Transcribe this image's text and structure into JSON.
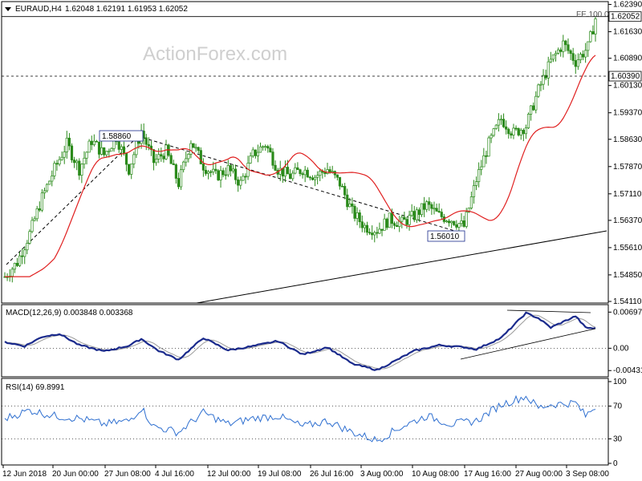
{
  "header": {
    "symbol": "EURAUD,H4",
    "ohlc": "1.62048 1.62191 1.61953 1.62052",
    "watermark": "ActionForex.com"
  },
  "chart_data": [
    {
      "type": "candlestick",
      "name": "price",
      "ylim": [
        1.5411,
        1.6238
      ],
      "y_ticks": [
        "1.62390",
        "1.61630",
        "1.60890",
        "1.60130",
        "1.59370",
        "1.58630",
        "1.57870",
        "1.57110",
        "1.56370",
        "1.55610",
        "1.54850",
        "1.54110"
      ],
      "y_tick_values": [
        1.6239,
        1.6163,
        1.6089,
        1.6013,
        1.5937,
        1.5863,
        1.5787,
        1.5711,
        1.5637,
        1.5561,
        1.5485,
        1.5411
      ],
      "x_ticks": [
        "12 Jun 2018",
        "20 Jun 00:00",
        "27 Jun 08:00",
        "4 Jul 16:00",
        "12 Jul 00:00",
        "19 Jul 08:00",
        "26 Jul 16:00",
        "3 Aug 00:00",
        "10 Aug 08:00",
        "17 Aug 16:00",
        "27 Aug 00:00",
        "3 Sep 08:00"
      ],
      "anchors": [
        {
          "i": 0,
          "v": 1.548
        },
        {
          "i": 5,
          "v": 1.552
        },
        {
          "i": 10,
          "v": 1.56
        },
        {
          "i": 15,
          "v": 1.57
        },
        {
          "i": 20,
          "v": 1.578
        },
        {
          "i": 25,
          "v": 1.585
        },
        {
          "i": 30,
          "v": 1.578
        },
        {
          "i": 35,
          "v": 1.586
        },
        {
          "i": 40,
          "v": 1.582
        },
        {
          "i": 45,
          "v": 1.587
        },
        {
          "i": 50,
          "v": 1.578
        },
        {
          "i": 55,
          "v": 1.5886
        },
        {
          "i": 60,
          "v": 1.58
        },
        {
          "i": 65,
          "v": 1.583
        },
        {
          "i": 70,
          "v": 1.574
        },
        {
          "i": 75,
          "v": 1.586
        },
        {
          "i": 80,
          "v": 1.579
        },
        {
          "i": 85,
          "v": 1.576
        },
        {
          "i": 90,
          "v": 1.578
        },
        {
          "i": 95,
          "v": 1.574
        },
        {
          "i": 100,
          "v": 1.582
        },
        {
          "i": 105,
          "v": 1.585
        },
        {
          "i": 110,
          "v": 1.578
        },
        {
          "i": 115,
          "v": 1.576
        },
        {
          "i": 120,
          "v": 1.578
        },
        {
          "i": 125,
          "v": 1.576
        },
        {
          "i": 130,
          "v": 1.578
        },
        {
          "i": 135,
          "v": 1.574
        },
        {
          "i": 140,
          "v": 1.566
        },
        {
          "i": 145,
          "v": 1.562
        },
        {
          "i": 150,
          "v": 1.561
        },
        {
          "i": 155,
          "v": 1.564
        },
        {
          "i": 160,
          "v": 1.563
        },
        {
          "i": 165,
          "v": 1.565
        },
        {
          "i": 170,
          "v": 1.568
        },
        {
          "i": 175,
          "v": 1.565
        },
        {
          "i": 180,
          "v": 1.564
        },
        {
          "i": 185,
          "v": 1.562
        },
        {
          "i": 190,
          "v": 1.575
        },
        {
          "i": 195,
          "v": 1.585
        },
        {
          "i": 200,
          "v": 1.592
        },
        {
          "i": 205,
          "v": 1.588
        },
        {
          "i": 210,
          "v": 1.59
        },
        {
          "i": 215,
          "v": 1.6
        },
        {
          "i": 220,
          "v": 1.608
        },
        {
          "i": 225,
          "v": 1.613
        },
        {
          "i": 230,
          "v": 1.608
        },
        {
          "i": 235,
          "v": 1.612
        },
        {
          "i": 238,
          "v": 1.62
        }
      ],
      "moving_average": {
        "lag": 10,
        "color": "#e02020"
      },
      "candle_color": "#2a8a1a",
      "levels": [
        {
          "label": "1.62052",
          "value": 1.62052,
          "style": "solid"
        },
        {
          "label": "1.60390",
          "value": 1.6039,
          "style": "dashed"
        }
      ],
      "annotations": [
        {
          "label": "1.58860",
          "value": 1.5886
        },
        {
          "label": "1.56010",
          "value": 1.5601
        },
        {
          "label": "FE 100.0",
          "value": 1.6205
        }
      ]
    },
    {
      "type": "line",
      "name": "macd",
      "legend": "MACD(12,26,9) 0.003848 0.003368",
      "ylim": [
        -0.0052,
        0.0078
      ],
      "y_ticks": [
        "0.006976",
        "0.00",
        "-0.00431"
      ],
      "y_tick_values": [
        0.006976,
        0.0,
        -0.00431
      ],
      "anchors": [
        {
          "i": 0,
          "v": 0.0012
        },
        {
          "i": 8,
          "v": 0.0004
        },
        {
          "i": 15,
          "v": 0.0022
        },
        {
          "i": 22,
          "v": 0.0028
        },
        {
          "i": 30,
          "v": 0.0006
        },
        {
          "i": 40,
          "v": -0.0006
        },
        {
          "i": 50,
          "v": 0.0005
        },
        {
          "i": 55,
          "v": 0.0018
        },
        {
          "i": 62,
          "v": -0.0005
        },
        {
          "i": 70,
          "v": -0.0022
        },
        {
          "i": 80,
          "v": 0.002
        },
        {
          "i": 90,
          "v": -0.0004
        },
        {
          "i": 100,
          "v": 0.0004
        },
        {
          "i": 110,
          "v": 0.0014
        },
        {
          "i": 120,
          "v": -0.0012
        },
        {
          "i": 130,
          "v": 0.0002
        },
        {
          "i": 140,
          "v": -0.003
        },
        {
          "i": 150,
          "v": -0.0042
        },
        {
          "i": 155,
          "v": -0.003
        },
        {
          "i": 165,
          "v": -0.0005
        },
        {
          "i": 175,
          "v": 0.0006
        },
        {
          "i": 185,
          "v": 0.0002
        },
        {
          "i": 190,
          "v": -0.0002
        },
        {
          "i": 200,
          "v": 0.002
        },
        {
          "i": 210,
          "v": 0.0068
        },
        {
          "i": 215,
          "v": 0.0058
        },
        {
          "i": 220,
          "v": 0.004
        },
        {
          "i": 230,
          "v": 0.0062
        },
        {
          "i": 234,
          "v": 0.004
        },
        {
          "i": 238,
          "v": 0.0038
        }
      ],
      "signal_lag": 5,
      "macd_color": "#1a2a8c",
      "signal_color": "#9a9a9a"
    },
    {
      "type": "line",
      "name": "rsi",
      "legend": "RSI(14) 69.8991",
      "ylim": [
        0,
        100
      ],
      "y_ticks": [
        "100",
        "70",
        "30",
        "0"
      ],
      "y_tick_values": [
        100,
        70,
        30,
        0
      ],
      "anchors": [
        {
          "i": 0,
          "v": 55
        },
        {
          "i": 10,
          "v": 65
        },
        {
          "i": 20,
          "v": 58
        },
        {
          "i": 30,
          "v": 55
        },
        {
          "i": 40,
          "v": 48
        },
        {
          "i": 50,
          "v": 52
        },
        {
          "i": 55,
          "v": 68
        },
        {
          "i": 60,
          "v": 45
        },
        {
          "i": 70,
          "v": 38
        },
        {
          "i": 80,
          "v": 62
        },
        {
          "i": 90,
          "v": 48
        },
        {
          "i": 100,
          "v": 55
        },
        {
          "i": 110,
          "v": 58
        },
        {
          "i": 120,
          "v": 45
        },
        {
          "i": 130,
          "v": 52
        },
        {
          "i": 140,
          "v": 38
        },
        {
          "i": 150,
          "v": 28
        },
        {
          "i": 160,
          "v": 45
        },
        {
          "i": 170,
          "v": 58
        },
        {
          "i": 180,
          "v": 48
        },
        {
          "i": 190,
          "v": 52
        },
        {
          "i": 200,
          "v": 72
        },
        {
          "i": 210,
          "v": 82
        },
        {
          "i": 215,
          "v": 68
        },
        {
          "i": 220,
          "v": 72
        },
        {
          "i": 230,
          "v": 74
        },
        {
          "i": 234,
          "v": 58
        },
        {
          "i": 238,
          "v": 69.9
        }
      ],
      "color": "#2e6fd0"
    }
  ]
}
